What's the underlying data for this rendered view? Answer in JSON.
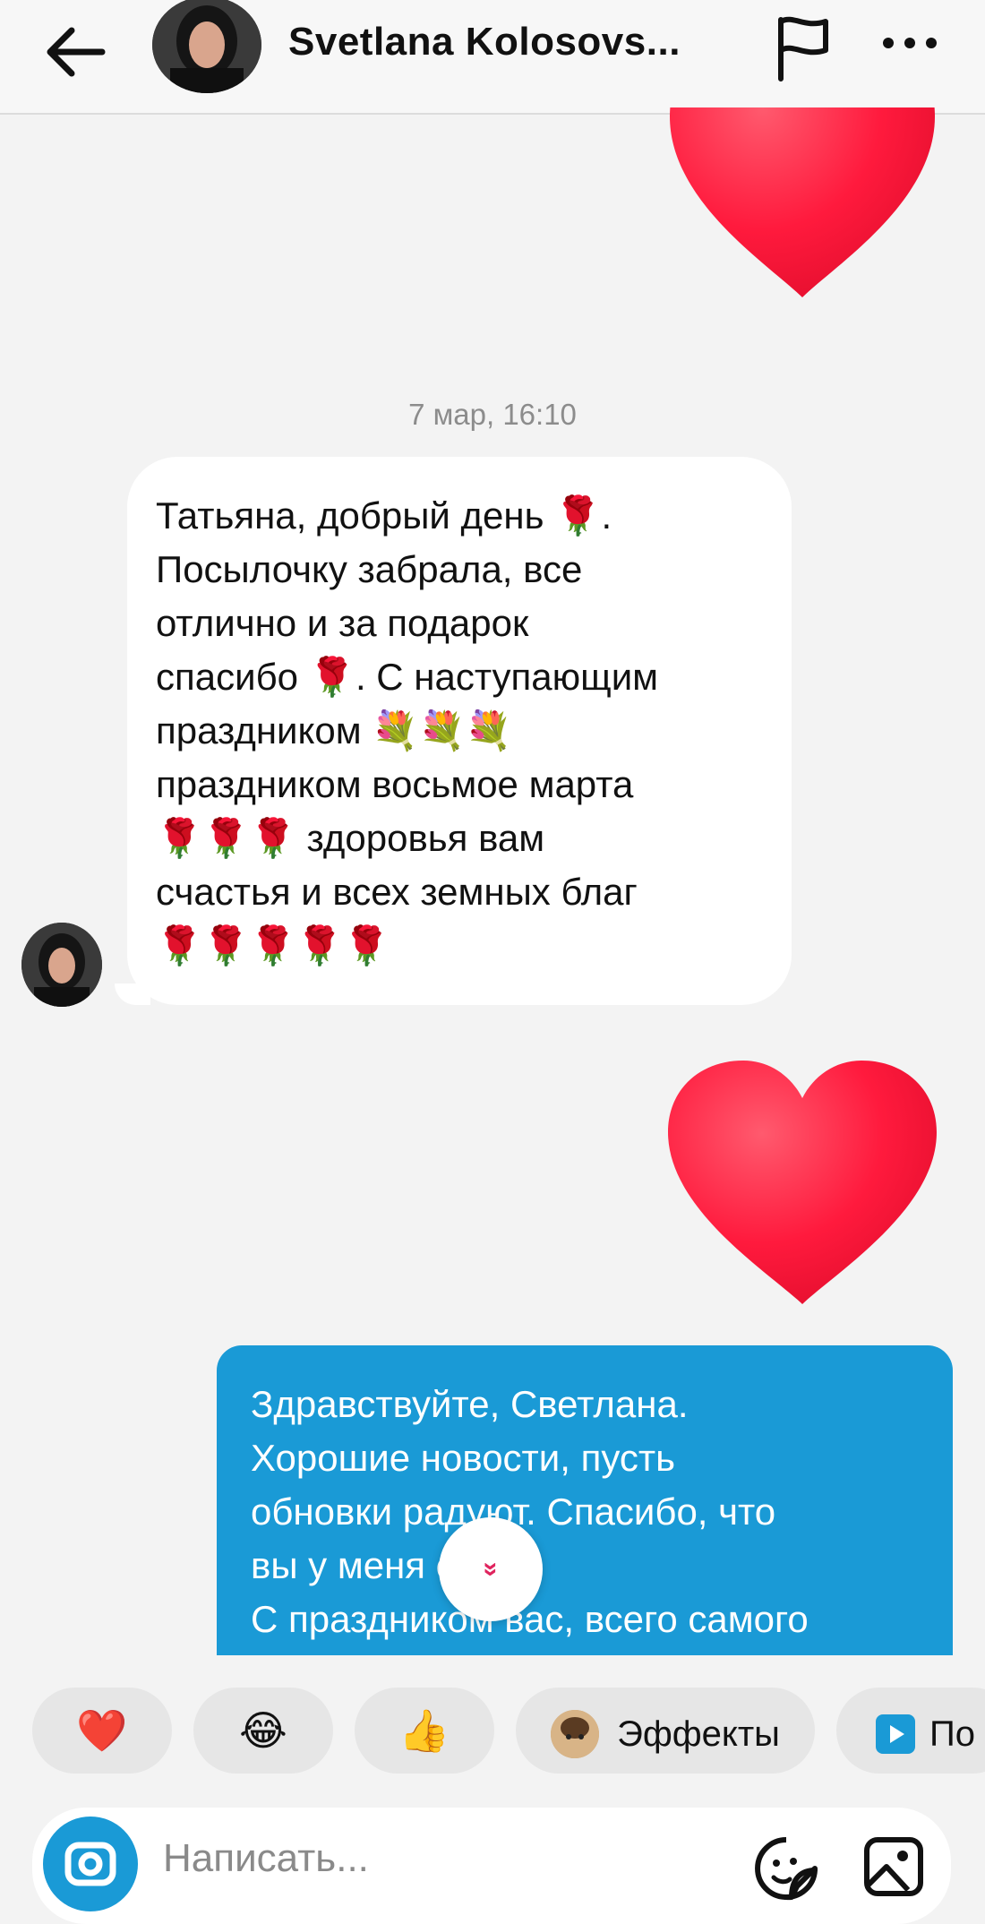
{
  "header": {
    "contact_name": "Svetlana Kolosovs...",
    "icons": [
      "back-arrow-icon",
      "flag-icon",
      "more-icon"
    ]
  },
  "chat": {
    "timestamp": "7 мар, 16:10",
    "incoming_message": "Татьяна, добрый день 🌹.\nПосылочку забрала, все\nотлично и за подарок\nспасибо 🌹. С наступающим\nпраздником 💐💐💐\nпраздником восьмое марта\n🌹🌹🌹 здоровья вам\nсчастья и всех земных благ\n🌹🌹🌹🌹🌹",
    "outgoing_message": "Здравствуйте, Светлана.\nХорошие новости, пусть\nобновки радуют. Спасибо, что\nвы у меня есть.\nС праздником вас, всего самого",
    "heart_reaction": "❤️",
    "scroll_down_icon": "»"
  },
  "quick_reactions": {
    "heart": "❤️",
    "laugh": "😂",
    "thumbs_up": "👍",
    "effects_label": "Эффекты",
    "next_label": "По"
  },
  "composer": {
    "placeholder": "Написать..."
  },
  "colors": {
    "accent": "#1a9ad6",
    "background": "#f3f3f3",
    "heart": "#ff1a3d"
  }
}
